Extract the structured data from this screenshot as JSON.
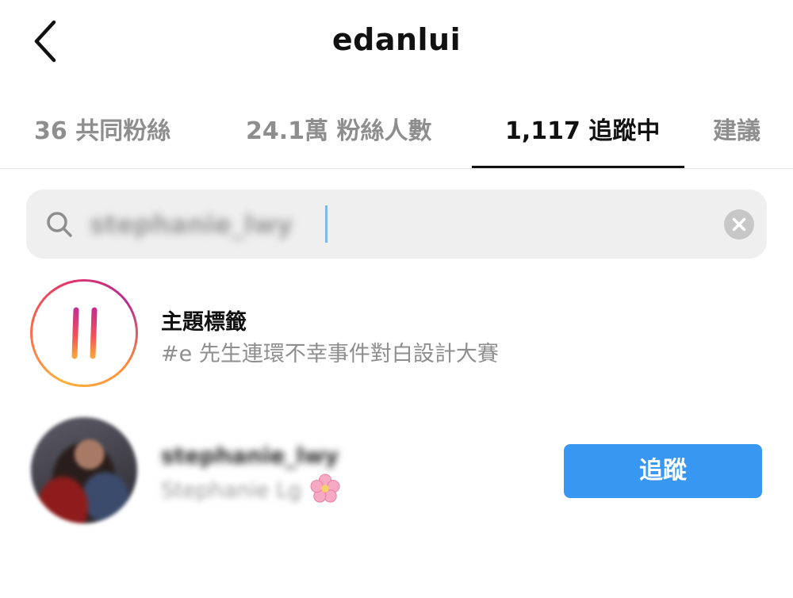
{
  "header": {
    "title": "edanlui",
    "back_icon": "chevron-left-icon"
  },
  "tabs": [
    {
      "label": "36 共同粉絲",
      "active": false
    },
    {
      "label": "24.1萬 粉絲人數",
      "active": false
    },
    {
      "label": "1,117 追蹤中",
      "active": true
    },
    {
      "label": "建議",
      "active": false
    }
  ],
  "search": {
    "value": "stephanie_lwy",
    "icon": "search-icon",
    "clear_icon": "clear-icon"
  },
  "results": {
    "hashtag": {
      "title": "主題標籤",
      "subtitle": "#e 先生連環不幸事件對白設計大賽",
      "icon": "hashtag-icon"
    },
    "user": {
      "username": "stephanie_lwy",
      "full_name": "Stephanie Lg",
      "emoji": "cherry-blossom-icon",
      "follow_label": "追蹤"
    }
  },
  "colors": {
    "accent": "#3897f0",
    "muted_text": "#8e8e8e",
    "search_bg": "#efefef"
  }
}
